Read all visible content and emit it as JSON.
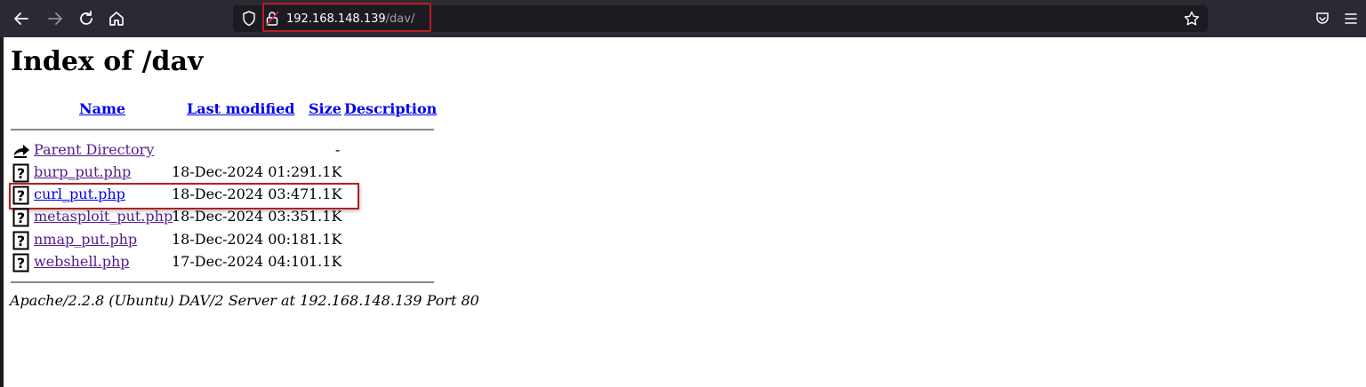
{
  "browser": {
    "url_host": "192.168.148.139",
    "url_path": "/dav/",
    "icons": {
      "back": "arrow-left-icon",
      "forward": "arrow-right-icon",
      "reload": "reload-icon",
      "home": "home-icon",
      "shield": "tracking-shield-icon",
      "lock": "insecure-lock-icon",
      "bookmark": "star-icon",
      "pocket": "pocket-icon",
      "menu": "hamburger-menu-icon"
    }
  },
  "page": {
    "title": "Index of /dav",
    "columns": {
      "name": "Name",
      "last_modified": "Last modified",
      "size": "Size",
      "description": "Description"
    },
    "parent": {
      "name": "Parent Directory",
      "size": "-"
    },
    "files": [
      {
        "name": "burp_put.php",
        "modified": "18-Dec-2024 01:29",
        "size": "1.1K"
      },
      {
        "name": "curl_put.php",
        "modified": "18-Dec-2024 03:47",
        "size": "1.1K"
      },
      {
        "name": "metasploit_put.php",
        "modified": "18-Dec-2024 03:35",
        "size": "1.1K"
      },
      {
        "name": "nmap_put.php",
        "modified": "18-Dec-2024 00:18",
        "size": "1.1K"
      },
      {
        "name": "webshell.php",
        "modified": "17-Dec-2024 04:10",
        "size": "1.1K"
      }
    ],
    "footer": "Apache/2.2.8 (Ubuntu) DAV/2 Server at 192.168.148.139 Port 80"
  },
  "colors": {
    "toolbar": "#2b2a33",
    "urlbar": "#1c1b22",
    "annotation": "#b42020",
    "link": "#0000ee",
    "visited": "#551a8b"
  }
}
